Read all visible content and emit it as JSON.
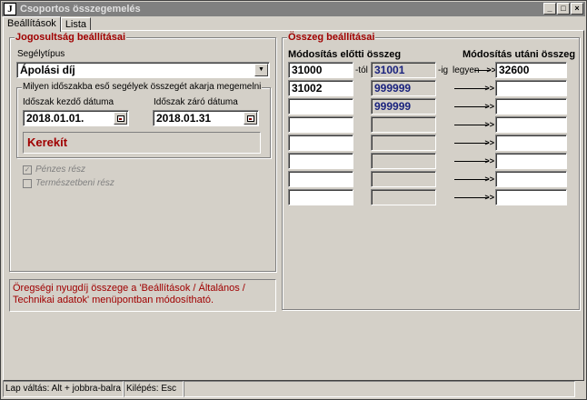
{
  "window": {
    "title": "Csoportos összegemelés",
    "icon_letter": "J",
    "controls": {
      "minimize": "_",
      "maximize": "□",
      "close": "×"
    }
  },
  "tabs": [
    {
      "label": "Beállítások",
      "active": true
    },
    {
      "label": "Lista",
      "active": false
    }
  ],
  "eligibility": {
    "title": "Jogosultság beállításai",
    "aid_type_label": "Segélytípus",
    "aid_type_value": "Ápolási díj",
    "period": {
      "title": "Milyen időszakba eső segélyek összegét akarja megemelni",
      "start_label": "Időszak kezdő dátuma",
      "start_value": "2018.01.01.",
      "end_label": "Időszak záró dátuma",
      "end_value": "2018.01.31"
    },
    "round_label": "Kerekít",
    "cash_part_label": "Pénzes rész",
    "in_kind_part_label": "Természetbeni rész"
  },
  "note_text": "Öregségi nyugdíj összege a 'Beállítások / Általános / Technikai adatok' menüpontban módosítható.",
  "amounts": {
    "title": "Összeg beállításai",
    "before_header": "Módosítás előtti összeg",
    "after_header": "Módosítás utáni összeg",
    "from_suffix": "-tól",
    "to_suffix": "-ig",
    "becomes_label": "legyen",
    "rows": [
      {
        "from": "31000",
        "to": "31001",
        "after": "32600"
      },
      {
        "from": "31002",
        "to": "999999",
        "after": ""
      },
      {
        "from": "",
        "to": "999999",
        "after": ""
      },
      {
        "from": "",
        "to": "",
        "after": ""
      },
      {
        "from": "",
        "to": "",
        "after": ""
      },
      {
        "from": "",
        "to": "",
        "after": ""
      },
      {
        "from": "",
        "to": "",
        "after": ""
      },
      {
        "from": "",
        "to": "",
        "after": ""
      }
    ]
  },
  "statusbar": {
    "page_switch": "Lap váltás: Alt + jobbra-balra nyíl",
    "exit": "Kilépés: Esc"
  }
}
